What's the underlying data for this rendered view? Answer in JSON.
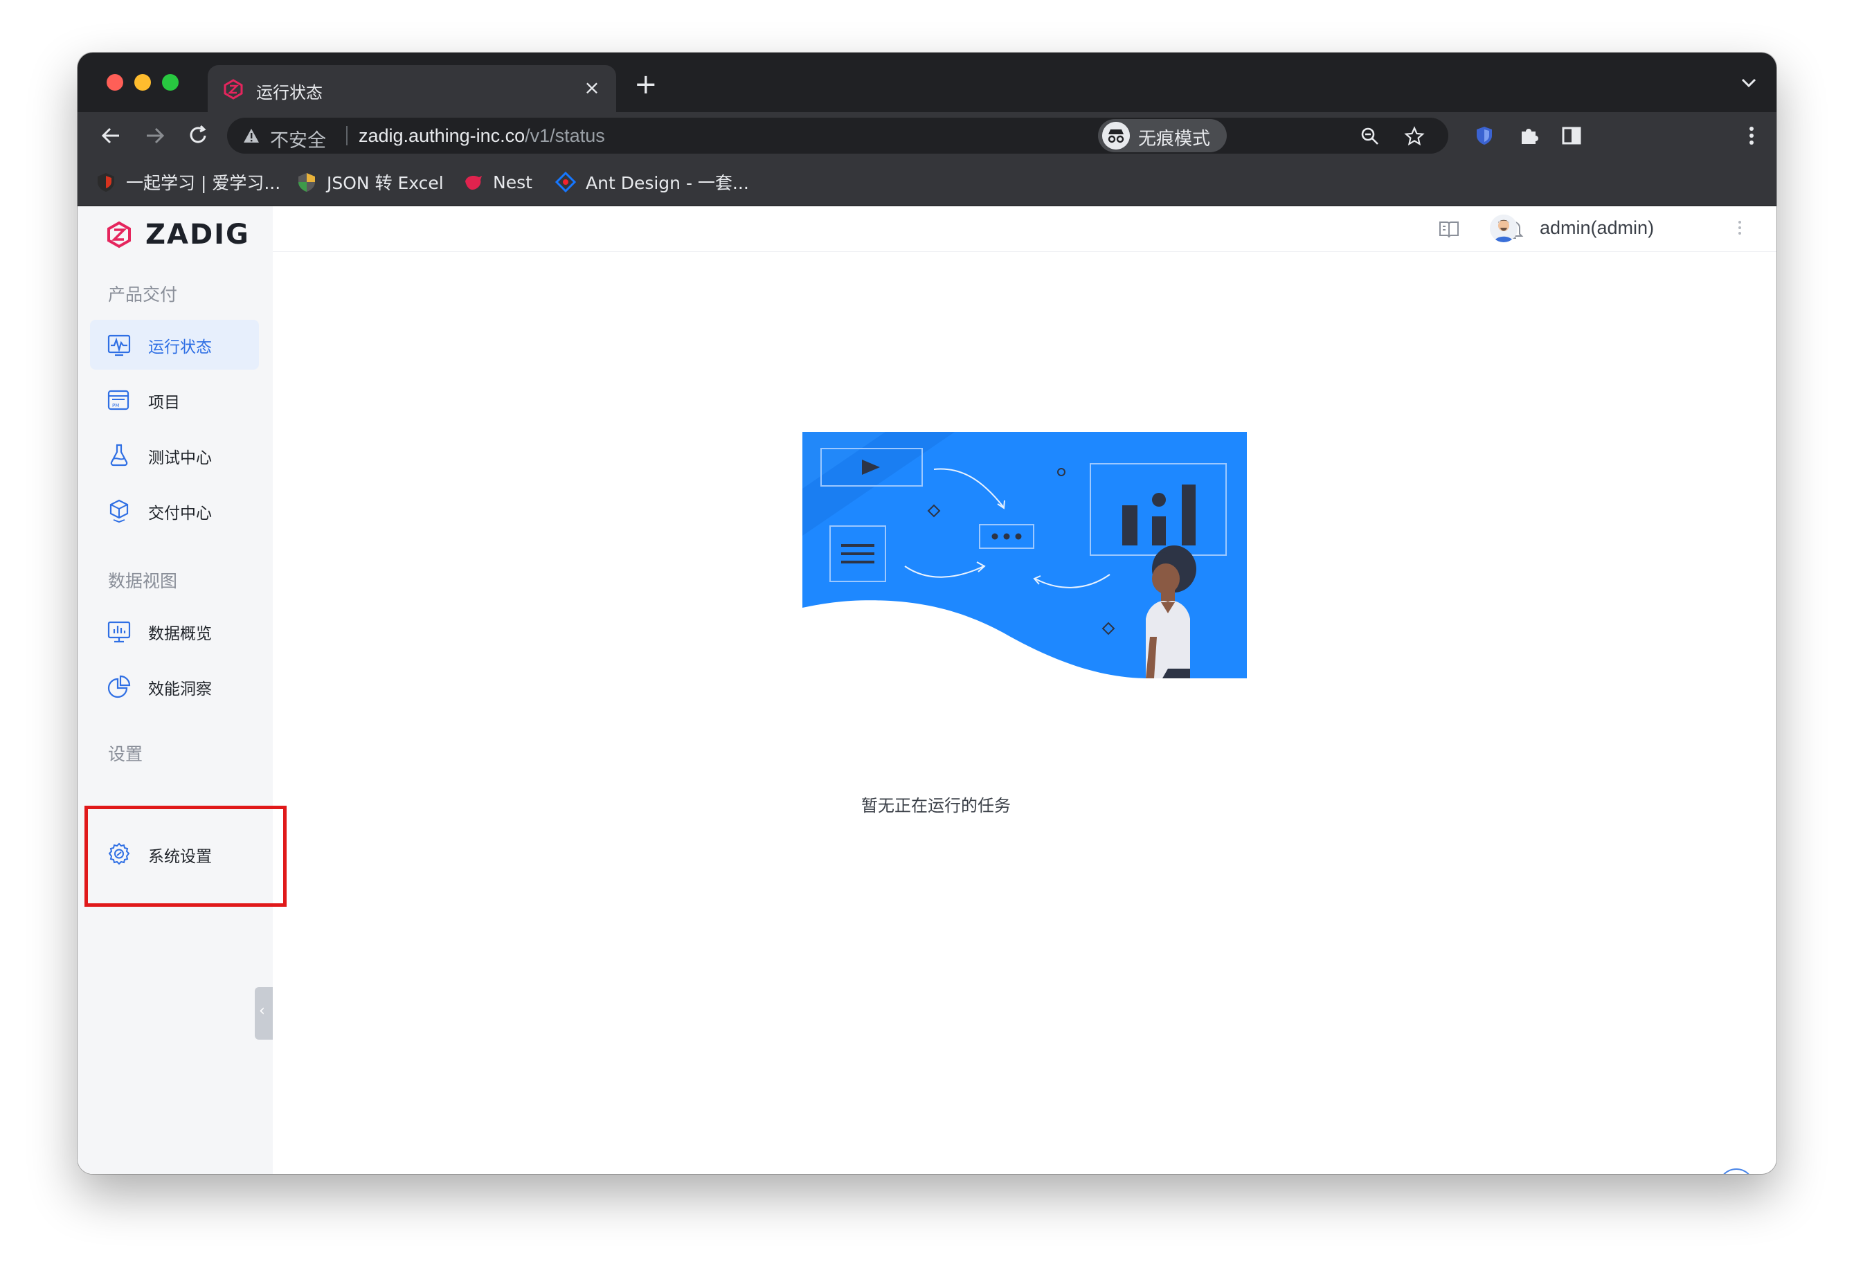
{
  "browser": {
    "tab": {
      "title": "运行状态",
      "favicon": "zadig-logo-icon",
      "close": "×"
    },
    "new_tab": "+",
    "address": {
      "security_label": "不安全",
      "host": "zadig.authing-inc.co",
      "path": "/v1/status"
    },
    "incognito_label": "无痕模式",
    "bookmarks": [
      {
        "label": "一起学习 | 爱学习...",
        "icon": "shield-red-icon"
      },
      {
        "label": "JSON 转 Excel",
        "icon": "shield-green-icon"
      },
      {
        "label": "Nest",
        "icon": "nest-cat-icon"
      },
      {
        "label": "Ant Design - 一套...",
        "icon": "ant-design-icon"
      }
    ]
  },
  "app": {
    "brand": "ZADIG",
    "colors": {
      "accent": "#2f6fe4",
      "brand_pink": "#e5255d",
      "illustration_blue": "#1e88ff",
      "highlight_red": "#e0191a"
    },
    "sidebar": {
      "groups": [
        {
          "title": "产品交付",
          "items": [
            {
              "label": "运行状态",
              "icon": "activity-monitor-icon",
              "active": true
            },
            {
              "label": "项目",
              "icon": "project-pm-icon",
              "active": false
            },
            {
              "label": "测试中心",
              "icon": "flask-icon",
              "active": false
            },
            {
              "label": "交付中心",
              "icon": "delivery-box-icon",
              "active": false
            }
          ]
        },
        {
          "title": "数据视图",
          "items": [
            {
              "label": "数据概览",
              "icon": "chart-screen-icon",
              "active": false
            },
            {
              "label": "效能洞察",
              "icon": "pie-chart-icon",
              "active": false
            }
          ]
        },
        {
          "title": "设置",
          "items": [
            {
              "label": "系统设置",
              "icon": "gear-icon",
              "active": false
            }
          ]
        }
      ],
      "collapse_glyph": "‹"
    },
    "header": {
      "user": "admin(admin)"
    },
    "main": {
      "empty_message": "暂无正在运行的任务"
    }
  }
}
